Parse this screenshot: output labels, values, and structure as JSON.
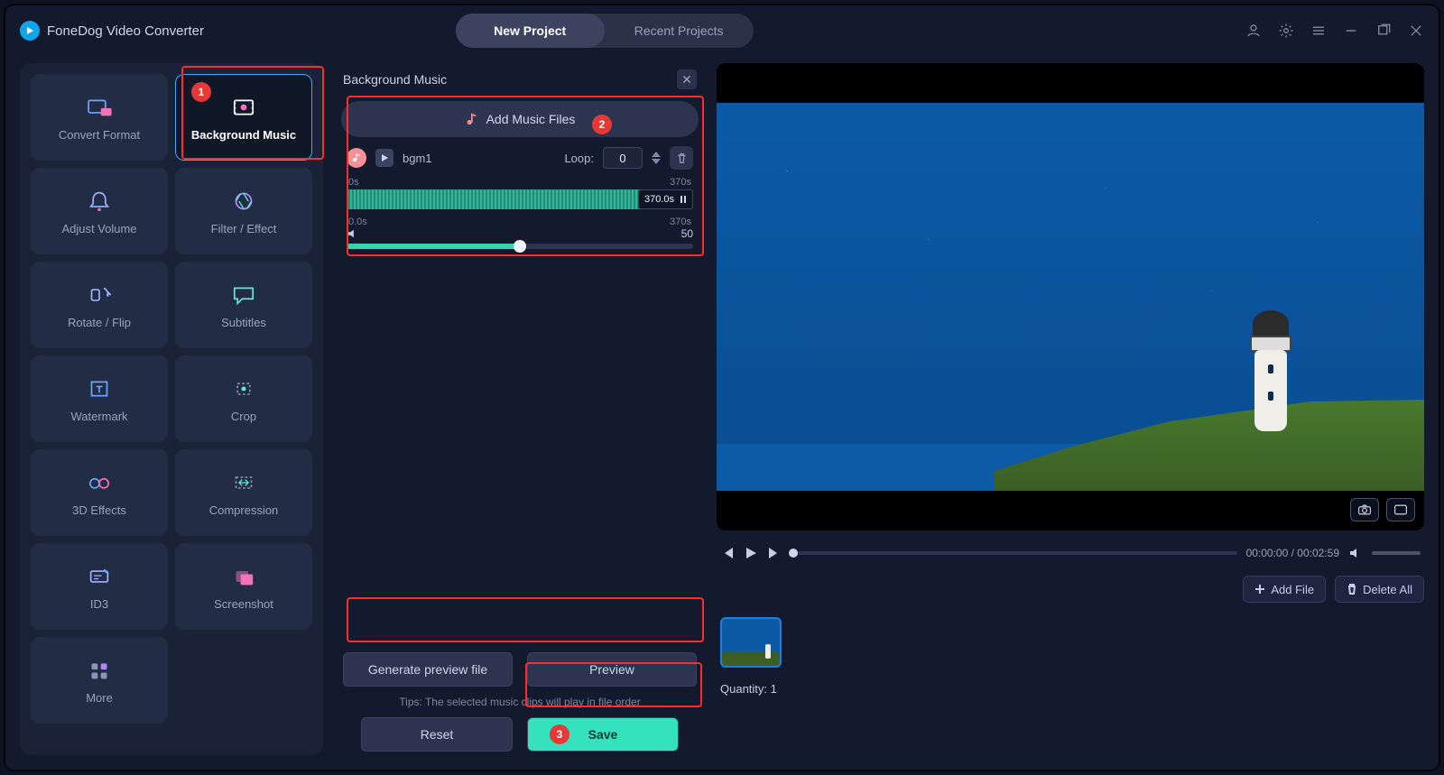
{
  "app": {
    "title": "FoneDog Video Converter"
  },
  "tabs": {
    "new": "New Project",
    "recent": "Recent Projects"
  },
  "sidebar": {
    "convert_format": "Convert Format",
    "background_music": "Background Music",
    "adjust_volume": "Adjust Volume",
    "filter_effect": "Filter / Effect",
    "rotate_flip": "Rotate / Flip",
    "subtitles": "Subtitles",
    "watermark": "Watermark",
    "crop": "Crop",
    "three_d": "3D Effects",
    "compression": "Compression",
    "id3": "ID3",
    "screenshot": "Screenshot",
    "more": "More"
  },
  "panel": {
    "title": "Background Music",
    "add_music": "Add Music Files",
    "track_name": "bgm1",
    "loop_label": "Loop:",
    "loop_value": "0",
    "wave_start": "0s",
    "wave_end": "370s",
    "wave_pos": "370.0s",
    "vol_start": "0.0s",
    "vol_end": "370s",
    "vol_value": "50",
    "generate": "Generate preview file",
    "preview": "Preview",
    "tips": "Tips: The selected music clips will play in file order",
    "reset": "Reset",
    "save": "Save"
  },
  "transport": {
    "time": "00:00:00 / 00:02:59"
  },
  "actions": {
    "add_file": "Add File",
    "delete_all": "Delete All"
  },
  "clips": {
    "quantity_label": "Quantity: 1"
  },
  "callouts": {
    "one": "1",
    "two": "2",
    "three": "3"
  }
}
